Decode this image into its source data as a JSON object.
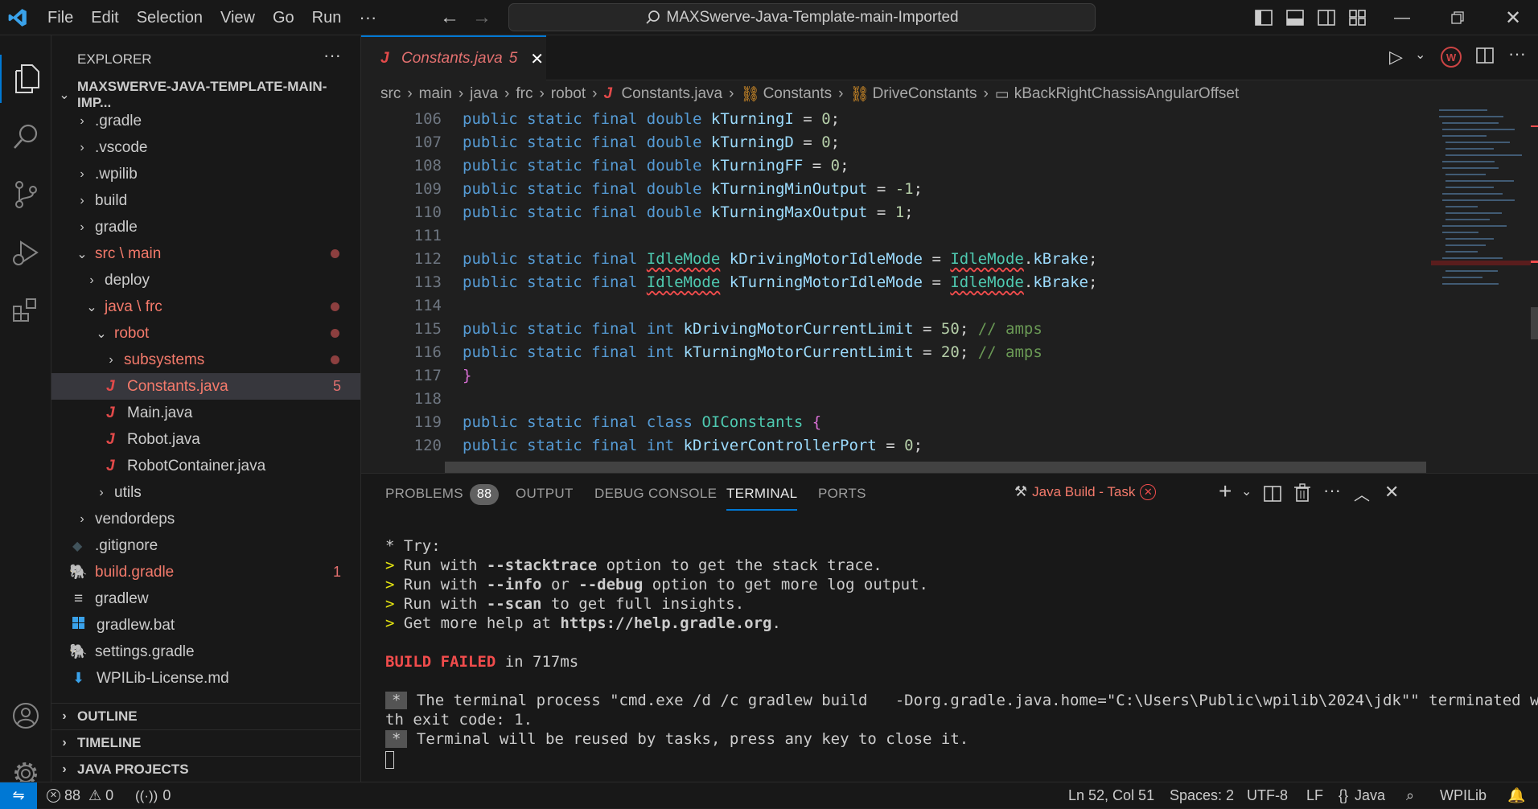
{
  "titlebar": {
    "menus": [
      "File",
      "Edit",
      "Selection",
      "View",
      "Go",
      "Run"
    ],
    "overflow": "···",
    "search_text": "MAXSwerve-Java-Template-main-Imported"
  },
  "explorer": {
    "title": "EXPLORER",
    "root": "MAXSWERVE-JAVA-TEMPLATE-MAIN-IMP...",
    "items": [
      {
        "label": ".gradle"
      },
      {
        "label": ".vscode"
      },
      {
        "label": ".wpilib"
      },
      {
        "label": "build"
      },
      {
        "label": "gradle"
      },
      {
        "label": "src \\ main"
      },
      {
        "label": "deploy"
      },
      {
        "label": "java \\ frc"
      },
      {
        "label": "robot"
      },
      {
        "label": "subsystems"
      },
      {
        "label": "Constants.java",
        "badge": "5"
      },
      {
        "label": "Main.java"
      },
      {
        "label": "Robot.java"
      },
      {
        "label": "RobotContainer.java"
      },
      {
        "label": "utils"
      },
      {
        "label": "vendordeps"
      },
      {
        "label": ".gitignore"
      },
      {
        "label": "build.gradle",
        "badge": "1"
      },
      {
        "label": "gradlew"
      },
      {
        "label": "gradlew.bat"
      },
      {
        "label": "settings.gradle"
      },
      {
        "label": "WPILib-License.md"
      }
    ],
    "sections": [
      "OUTLINE",
      "TIMELINE",
      "JAVA PROJECTS"
    ]
  },
  "editor": {
    "tab": {
      "label": "Constants.java",
      "problems": "5"
    },
    "breadcrumb": [
      "src",
      "main",
      "java",
      "frc",
      "robot",
      "Constants.java",
      "Constants",
      "DriveConstants",
      "kBackRightChassisAngularOffset"
    ],
    "line_numbers": [
      "106",
      "107",
      "108",
      "109",
      "110",
      "111",
      "112",
      "113",
      "114",
      "115",
      "116",
      "117",
      "118",
      "119",
      "120"
    ]
  },
  "panel": {
    "tabs": [
      "PROBLEMS",
      "OUTPUT",
      "DEBUG CONSOLE",
      "TERMINAL",
      "PORTS"
    ],
    "problems_count": "88",
    "task_label": "Java Build - Task",
    "terminal": {
      "try": "* Try:",
      "l1_a": "Run with ",
      "l1_b": "--stacktrace",
      "l1_c": " option to get the stack trace.",
      "l2_a": "Run with ",
      "l2_b": "--info",
      "l2_c": " or ",
      "l2_d": "--debug",
      "l2_e": " option to get more log output.",
      "l3_a": "Run with ",
      "l3_b": "--scan",
      "l3_c": " to get full insights.",
      "l4_a": "Get more help at ",
      "l4_b": "https://help.gradle.org",
      "l4_c": ".",
      "fail_a": "BUILD FAILED",
      "fail_b": " in 717ms",
      "proc1": " The terminal process \"cmd.exe /d /c gradlew build   -Dorg.gradle.java.home=\"C:\\Users\\Public\\wpilib\\2024\\jdk\"\" terminated wi",
      "proc2": "th exit code: 1.",
      "reuse": " Terminal will be reused by tasks, press any key to close it.",
      "star": "*",
      "prompt": ">"
    }
  },
  "statusbar": {
    "errors": "88",
    "warnings": "0",
    "ports": "0",
    "position": "Ln 52, Col 51",
    "spaces": "Spaces: 2",
    "encoding": "UTF-8",
    "eol": "LF",
    "language": "Java",
    "wpilib": "WPILib"
  },
  "colors": {
    "accent": "#0078d4",
    "error": "#f14c4c",
    "modified": "#e3706f"
  }
}
